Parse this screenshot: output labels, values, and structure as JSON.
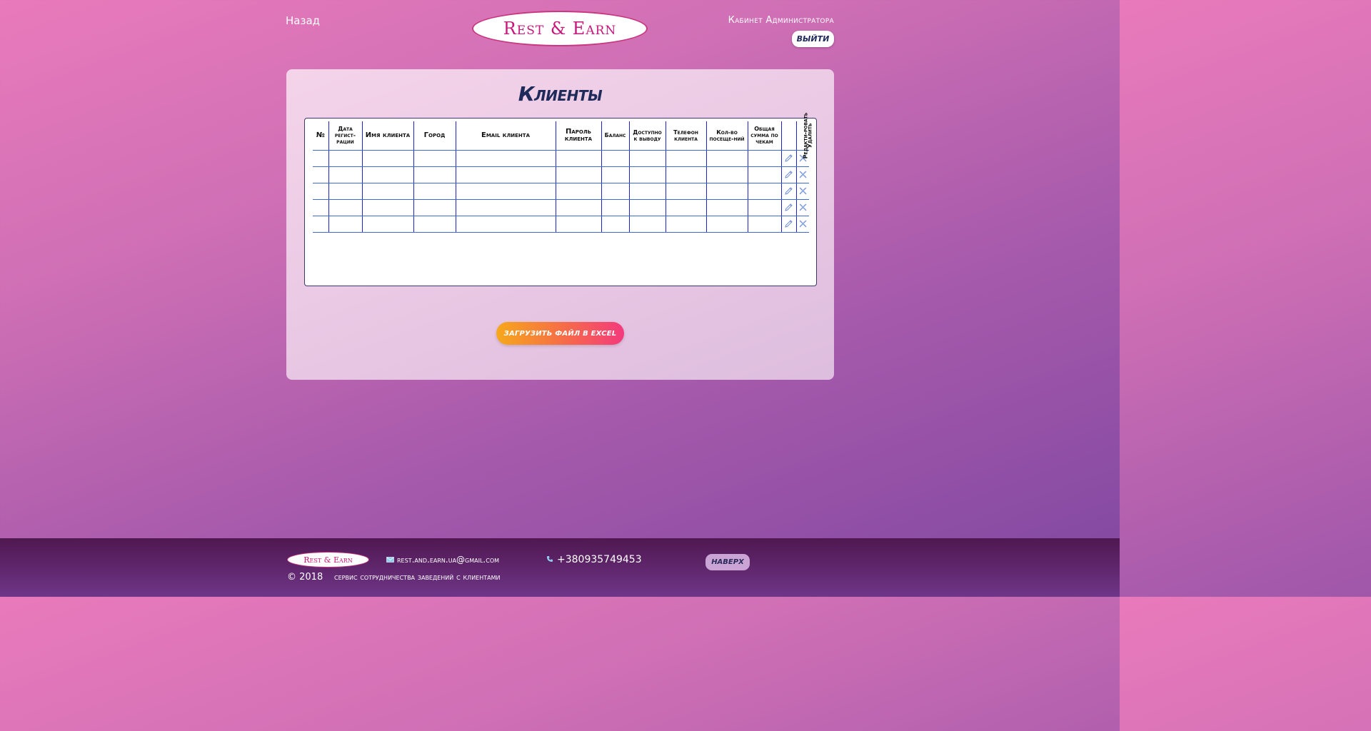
{
  "header": {
    "back_label": "Назад",
    "logo_text": "Rest & Earn",
    "cabinet_label": "Кабинет Администратора",
    "logout_label": "ВЫЙТИ"
  },
  "main": {
    "title": "Клиенты",
    "columns": [
      "№",
      "Дата регист-рации",
      "Имя клиента",
      "Город",
      "Email клиента",
      "Пароль клиента",
      "Баланс",
      "Доступно к выводу",
      "Телефон клиента",
      "Кол-во посеще-ний",
      "Общая сумма по чекам",
      "Редакти-ровать",
      "Удалить"
    ],
    "row_count": 5,
    "upload_button_label": "ЗАГРУЗИТЬ ФАЙЛ В EXCEL"
  },
  "footer": {
    "logo_text": "Rest & Earn",
    "email": "rest.and.earn.ua@gmail.com",
    "phone": "+380935749453",
    "top_button_label": "НАВЕРХ",
    "copyright": "© 2018",
    "description": "сервис сотрудничества заведений с клиентами"
  },
  "icons": {
    "edit": "pencil-icon",
    "delete": "cross-icon",
    "mail": "envelope-icon",
    "phone": "phone-icon"
  },
  "colors": {
    "accent_pink": "#c8177a",
    "title_navy": "#1e2a5a",
    "table_lines": "#2222cc",
    "upload_orange": "#f6a81b",
    "upload_pink": "#f33a7d",
    "footer_purple": "#4f1850"
  }
}
